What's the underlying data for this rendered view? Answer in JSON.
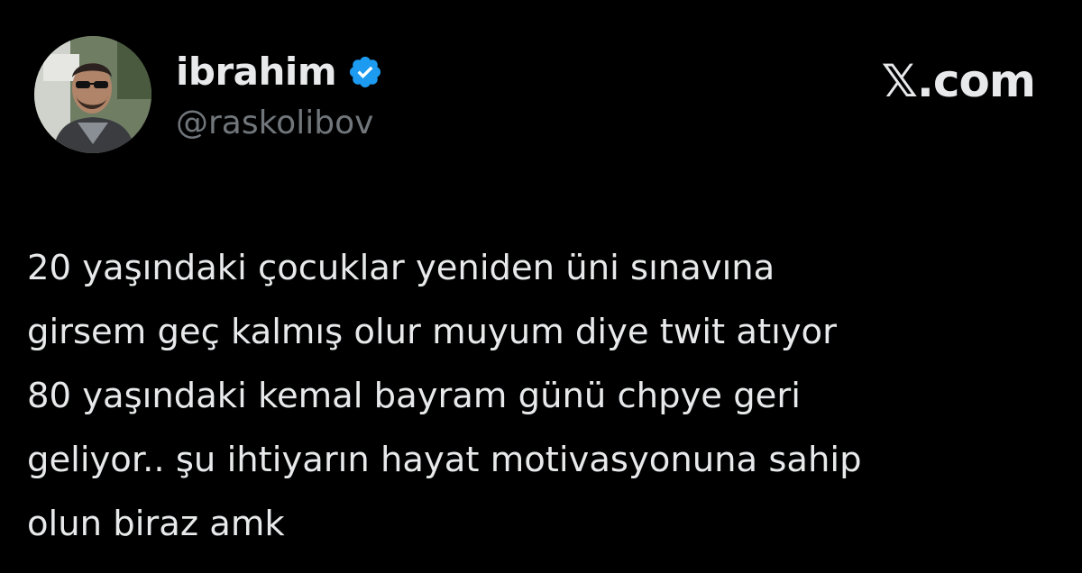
{
  "author": {
    "display_name": "ibrahim",
    "handle": "@raskolibov",
    "verified": true,
    "avatar_icon": "profile-photo"
  },
  "brand": {
    "label": "𝕏.com"
  },
  "tweet": {
    "text": "20 yaşındaki çocuklar yeniden üni sınavına\ngirsem geç kalmış olur muyum diye twit atıyor\n80 yaşındaki kemal bayram günü chpye geri\ngeliyor.. şu ihtiyarın hayat motivasyonuna sahip\nolun biraz amk"
  },
  "colors": {
    "background": "#000000",
    "text_primary": "#e7e9ea",
    "text_secondary": "#71767b",
    "verified_blue": "#1d9bf0"
  }
}
